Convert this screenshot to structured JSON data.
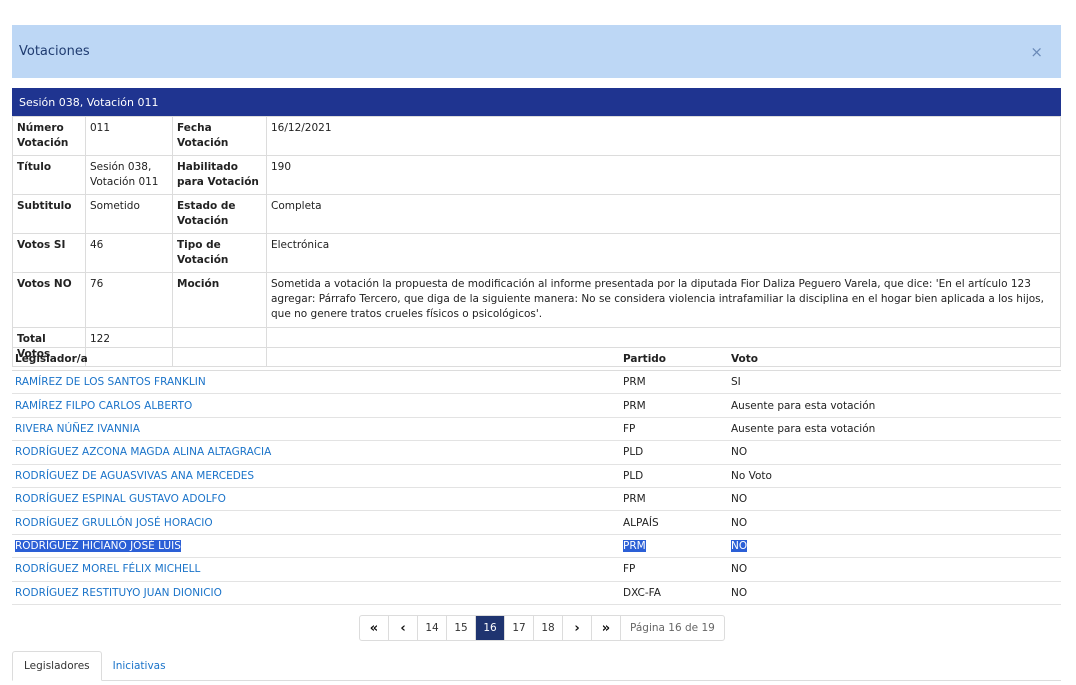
{
  "modal": {
    "title": "Votaciones",
    "close_glyph": "×"
  },
  "session_bar": "Sesión 038, Votación 011",
  "details": {
    "numero_label": "Número Votación",
    "numero_value": "011",
    "fecha_label": "Fecha Votación",
    "fecha_value": "16/12/2021",
    "titulo_label": "Título",
    "titulo_value": "Sesión 038, Votación 011",
    "habilitado_label": "Habilitado para Votación",
    "habilitado_value": "190",
    "subtitulo_label": "Subtitulo",
    "subtitulo_value": "Sometido",
    "estado_label": "Estado de Votación",
    "estado_value": "Completa",
    "si_label": "Votos SI",
    "si_value": "46",
    "tipo_label": "Tipo de Votación",
    "tipo_value": "Electrónica",
    "no_label": "Votos NO",
    "no_value": "76",
    "mocion_label": "Moción",
    "mocion_value": "Sometida a votación la propuesta de modificación al informe presentada por la diputada Fior Daliza Peguero Varela, que dice: 'En el artículo 123 agregar: Párrafo Tercero, que diga de la siguiente manera: No se considera violencia intrafamiliar la disciplina en el hogar bien aplicada a los hijos, que no genere tratos crueles físicos o psicológicos'.",
    "total_label": "Total Votos",
    "total_value": "122"
  },
  "legis_table": {
    "headers": {
      "legislador": "Legislador/a",
      "partido": "Partido",
      "voto": "Voto"
    },
    "rows": [
      {
        "name": "RAMÍREZ DE LOS SANTOS FRANKLIN",
        "party": "PRM",
        "vote": "SI"
      },
      {
        "name": "RAMÍREZ FILPO CARLOS ALBERTO",
        "party": "PRM",
        "vote": "Ausente para esta votación"
      },
      {
        "name": "RIVERA NÚÑEZ IVANNIA",
        "party": "FP",
        "vote": "Ausente para esta votación"
      },
      {
        "name": "RODRÍGUEZ AZCONA MAGDA ALINA ALTAGRACIA",
        "party": "PLD",
        "vote": "NO"
      },
      {
        "name": "RODRÍGUEZ DE AGUASVIVAS ANA MERCEDES",
        "party": "PLD",
        "vote": "No Voto"
      },
      {
        "name": "RODRÍGUEZ ESPINAL GUSTAVO ADOLFO",
        "party": "PRM",
        "vote": "NO"
      },
      {
        "name": "RODRÍGUEZ GRULLÓN JOSÉ HORACIO",
        "party": "ALPAÍS",
        "vote": "NO"
      },
      {
        "name": "RODRÍGUEZ HICIANO JOSÉ LUIS",
        "party": "PRM",
        "vote": "NO"
      },
      {
        "name": "RODRÍGUEZ MOREL FÉLIX MICHELL",
        "party": "FP",
        "vote": "NO"
      },
      {
        "name": "RODRÍGUEZ RESTITUYO JUAN DIONICIO",
        "party": "DXC-FA",
        "vote": "NO"
      }
    ]
  },
  "pager": {
    "first": "«",
    "prev": "‹",
    "next": "›",
    "last": "»",
    "pages": [
      "14",
      "15",
      "16",
      "17",
      "18"
    ],
    "current": "16",
    "info": "Página 16 de 19"
  },
  "tabs": {
    "legisladores": "Legisladores",
    "iniciativas": "Iniciativas"
  }
}
